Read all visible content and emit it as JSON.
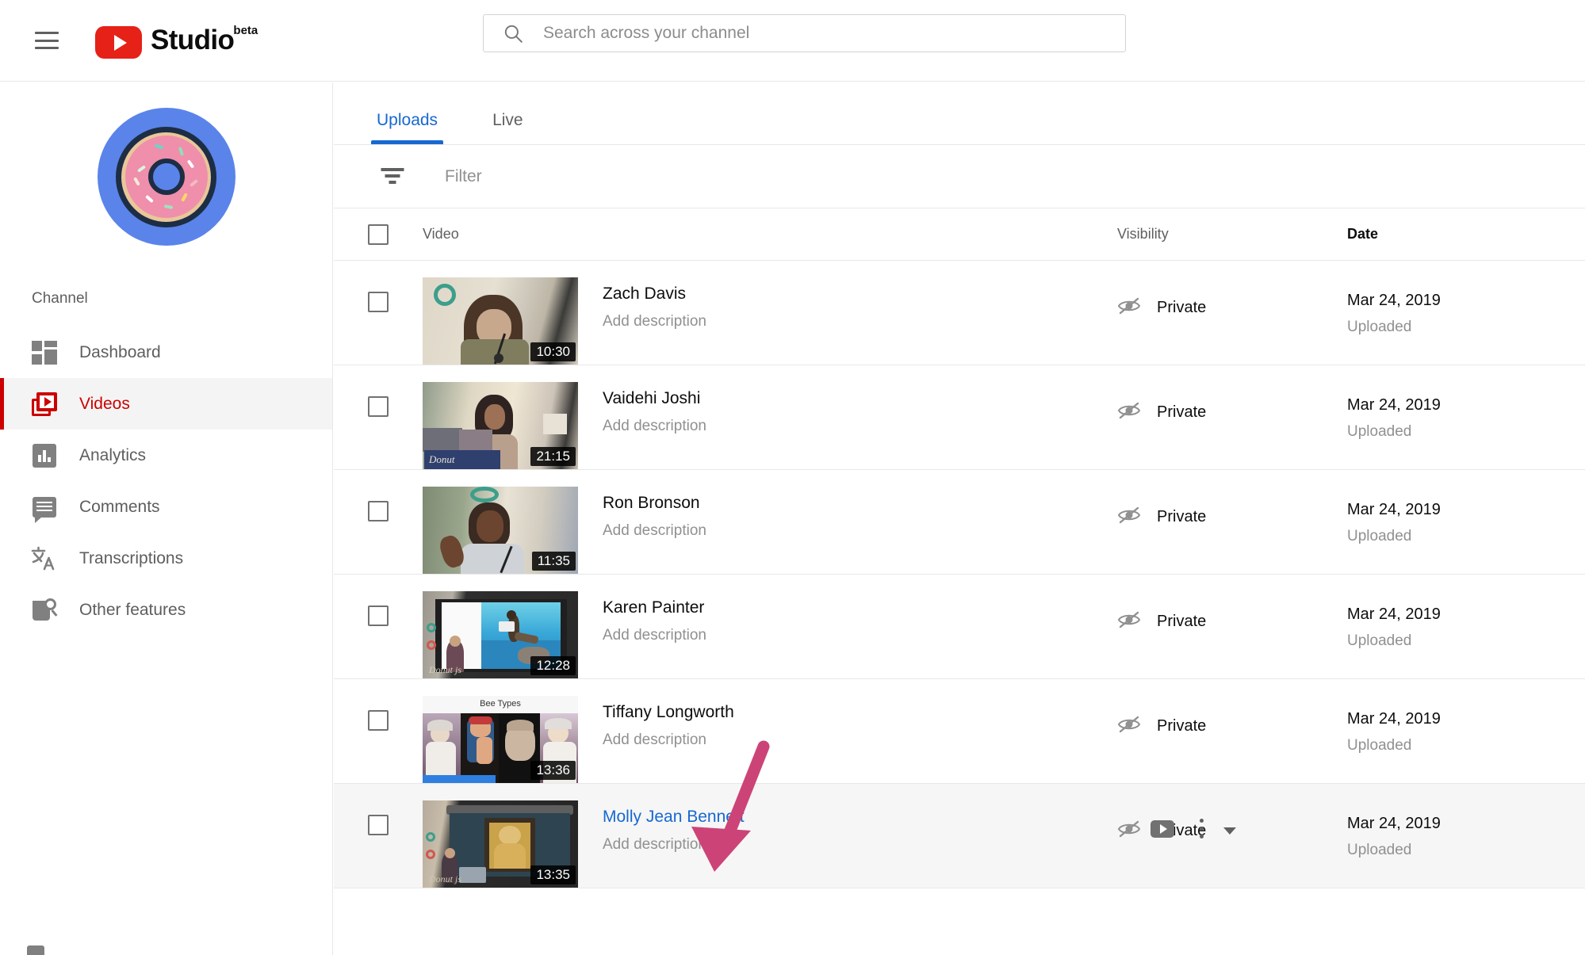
{
  "header": {
    "menu_icon": "hamburger-icon",
    "brand": "Studio",
    "brand_superscript": "beta",
    "logo_icon": "youtube-logo-icon",
    "search": {
      "placeholder": "Search across your channel",
      "value": "",
      "icon": "search-icon"
    }
  },
  "sidebar": {
    "avatar_icon": "donut-avatar",
    "section_label": "Channel",
    "items": [
      {
        "label": "Dashboard",
        "icon": "dashboard-icon",
        "active": false
      },
      {
        "label": "Videos",
        "icon": "videos-icon",
        "active": true
      },
      {
        "label": "Analytics",
        "icon": "analytics-icon",
        "active": false
      },
      {
        "label": "Comments",
        "icon": "comments-icon",
        "active": false
      },
      {
        "label": "Transcriptions",
        "icon": "translate-icon",
        "active": false
      },
      {
        "label": "Other features",
        "icon": "other-features-icon",
        "active": false
      }
    ]
  },
  "main": {
    "tabs": [
      {
        "label": "Uploads",
        "active": true
      },
      {
        "label": "Live",
        "active": false
      }
    ],
    "filter": {
      "icon": "filter-icon",
      "placeholder": "Filter",
      "value": ""
    },
    "table": {
      "headers": {
        "select_all": "select-all-checkbox",
        "video": "Video",
        "visibility": "Visibility",
        "date": "Date"
      },
      "rows": [
        {
          "title": "Zach Davis",
          "description": "Add description",
          "duration": "10:30",
          "visibility": "Private",
          "visibility_icon": "eye-off-icon",
          "date": "Mar 24, 2019",
          "date_sub": "Uploaded",
          "hovered": false
        },
        {
          "title": "Vaidehi Joshi",
          "description": "Add description",
          "duration": "21:15",
          "visibility": "Private",
          "visibility_icon": "eye-off-icon",
          "date": "Mar 24, 2019",
          "date_sub": "Uploaded",
          "hovered": false
        },
        {
          "title": "Ron Bronson",
          "description": "Add description",
          "duration": "11:35",
          "visibility": "Private",
          "visibility_icon": "eye-off-icon",
          "date": "Mar 24, 2019",
          "date_sub": "Uploaded",
          "hovered": false
        },
        {
          "title": "Karen Painter",
          "description": "Add description",
          "duration": "12:28",
          "visibility": "Private",
          "visibility_icon": "eye-off-icon",
          "date": "Mar 24, 2019",
          "date_sub": "Uploaded",
          "hovered": false
        },
        {
          "title": "Tiffany Longworth",
          "description": "Add description",
          "duration": "13:36",
          "visibility": "Private",
          "visibility_icon": "eye-off-icon",
          "date": "Mar 24, 2019",
          "date_sub": "Uploaded",
          "hovered": false
        },
        {
          "title": "Molly Jean Bennett",
          "description": "Add description",
          "duration": "13:35",
          "visibility": "Private",
          "visibility_icon": "eye-off-icon",
          "date": "Mar 24, 2019",
          "date_sub": "Uploaded",
          "hovered": true
        }
      ],
      "row_actions": {
        "watch_icon": "youtube-play-icon",
        "more_icon": "more-vertical-icon",
        "visibility_caret": "chevron-down-icon"
      }
    }
  },
  "annotation": {
    "type": "arrow",
    "color": "#cc4477",
    "points_to": "Molly Jean Bennett"
  },
  "colors": {
    "accent_red": "#cc0000",
    "accent_blue": "#1768d1",
    "annotation_pink": "#cc4477",
    "text_primary": "#0d0d0d",
    "text_secondary": "#606060",
    "text_muted": "#909090"
  }
}
